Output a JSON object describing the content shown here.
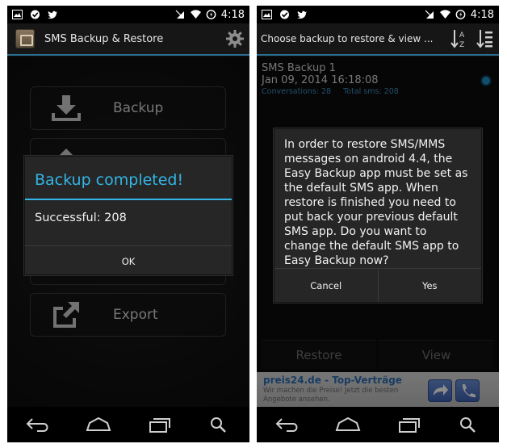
{
  "left": {
    "status_time": "4:18",
    "app_title": "SMS Backup & Restore",
    "buttons": {
      "backup": "Backup",
      "export": "Export"
    },
    "dialog": {
      "title": "Backup completed!",
      "message": "Successful: 208",
      "ok": "OK"
    }
  },
  "right": {
    "status_time": "4:18",
    "title": "Choose backup to restore & view ...",
    "backup_item": {
      "title": "SMS Backup 1",
      "date": "Jan 09, 2014 16:18:08",
      "conversations": "Conversations: 28",
      "total_sms": "Total sms: 208"
    },
    "dialog": {
      "message": "In order to restore SMS/MMS messages on android 4.4, the Easy Backup app must be set as the default SMS app. When restore is finished you need to put back your previous default SMS app. Do you want to change the default SMS app to Easy Backup now?",
      "cancel": "Cancel",
      "yes": "Yes"
    },
    "buttons": {
      "restore": "Restore",
      "view": "View"
    },
    "ad": {
      "title": "preis24.de - Top-Verträge",
      "text": "Wir machen die Preise! Jetzt die besten Angebote ansehen."
    }
  },
  "colors": {
    "accent": "#33b5e5",
    "link_blue": "#3e8fc0",
    "divider_blue": "#2b6f91"
  }
}
